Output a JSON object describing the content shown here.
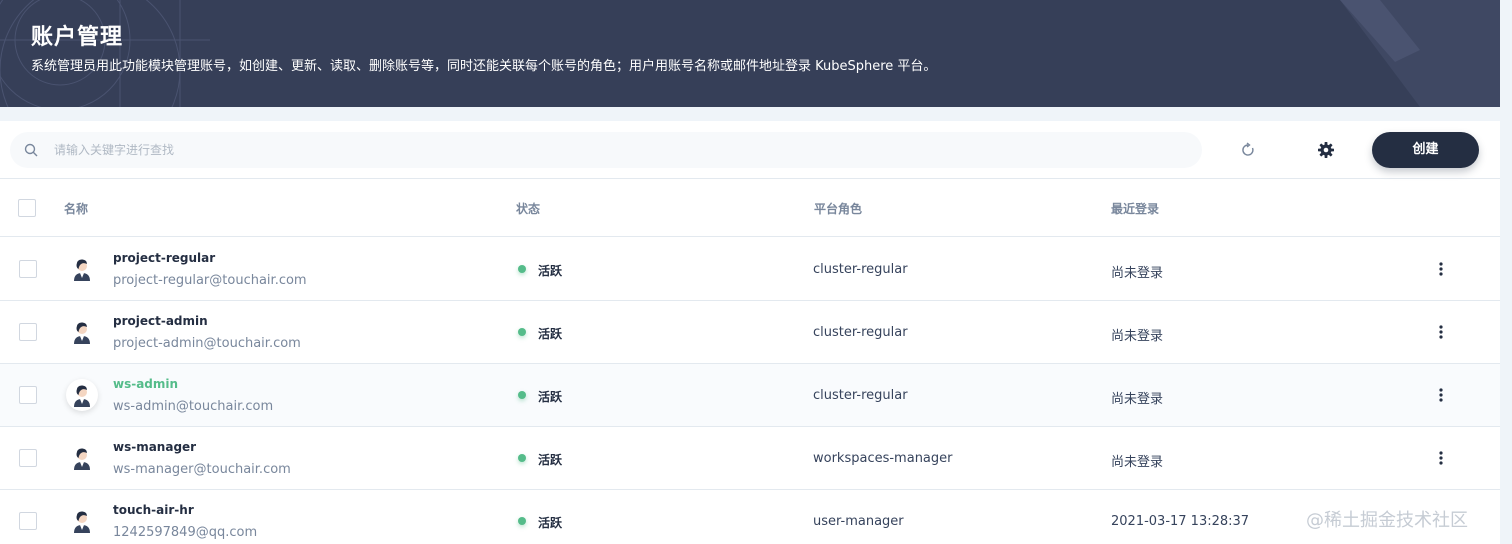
{
  "header": {
    "title": "账户管理",
    "description": "系统管理员用此功能模块管理账号，如创建、更新、读取、删除账号等，同时还能关联每个账号的角色；用户用账号名称或邮件地址登录 KubeSphere 平台。"
  },
  "toolbar": {
    "search_placeholder": "请输入关键字进行查找",
    "create_label": "创建"
  },
  "table": {
    "columns": {
      "name": "名称",
      "status": "状态",
      "role": "平台角色",
      "last_login": "最近登录"
    },
    "rows": [
      {
        "name": "project-regular",
        "email": "project-regular@touchair.com",
        "status": "活跃",
        "role": "cluster-regular",
        "last_login": "尚未登录"
      },
      {
        "name": "project-admin",
        "email": "project-admin@touchair.com",
        "status": "活跃",
        "role": "cluster-regular",
        "last_login": "尚未登录"
      },
      {
        "name": "ws-admin",
        "email": "ws-admin@touchair.com",
        "status": "活跃",
        "role": "cluster-regular",
        "last_login": "尚未登录"
      },
      {
        "name": "ws-manager",
        "email": "ws-manager@touchair.com",
        "status": "活跃",
        "role": "workspaces-manager",
        "last_login": "尚未登录"
      },
      {
        "name": "touch-air-hr",
        "email": "1242597849@qq.com",
        "status": "活跃",
        "role": "user-manager",
        "last_login": "2021-03-17 13:28:37"
      }
    ]
  },
  "watermark": "@稀土掘金技术社区",
  "colors": {
    "banner": "#363f58",
    "primary_dark": "#242e42",
    "active_green": "#55bc8a",
    "page_bg": "#eff4f9"
  },
  "icons": [
    "search-icon",
    "refresh-icon",
    "gear-icon",
    "avatar-icon",
    "more-vertical-icon"
  ]
}
